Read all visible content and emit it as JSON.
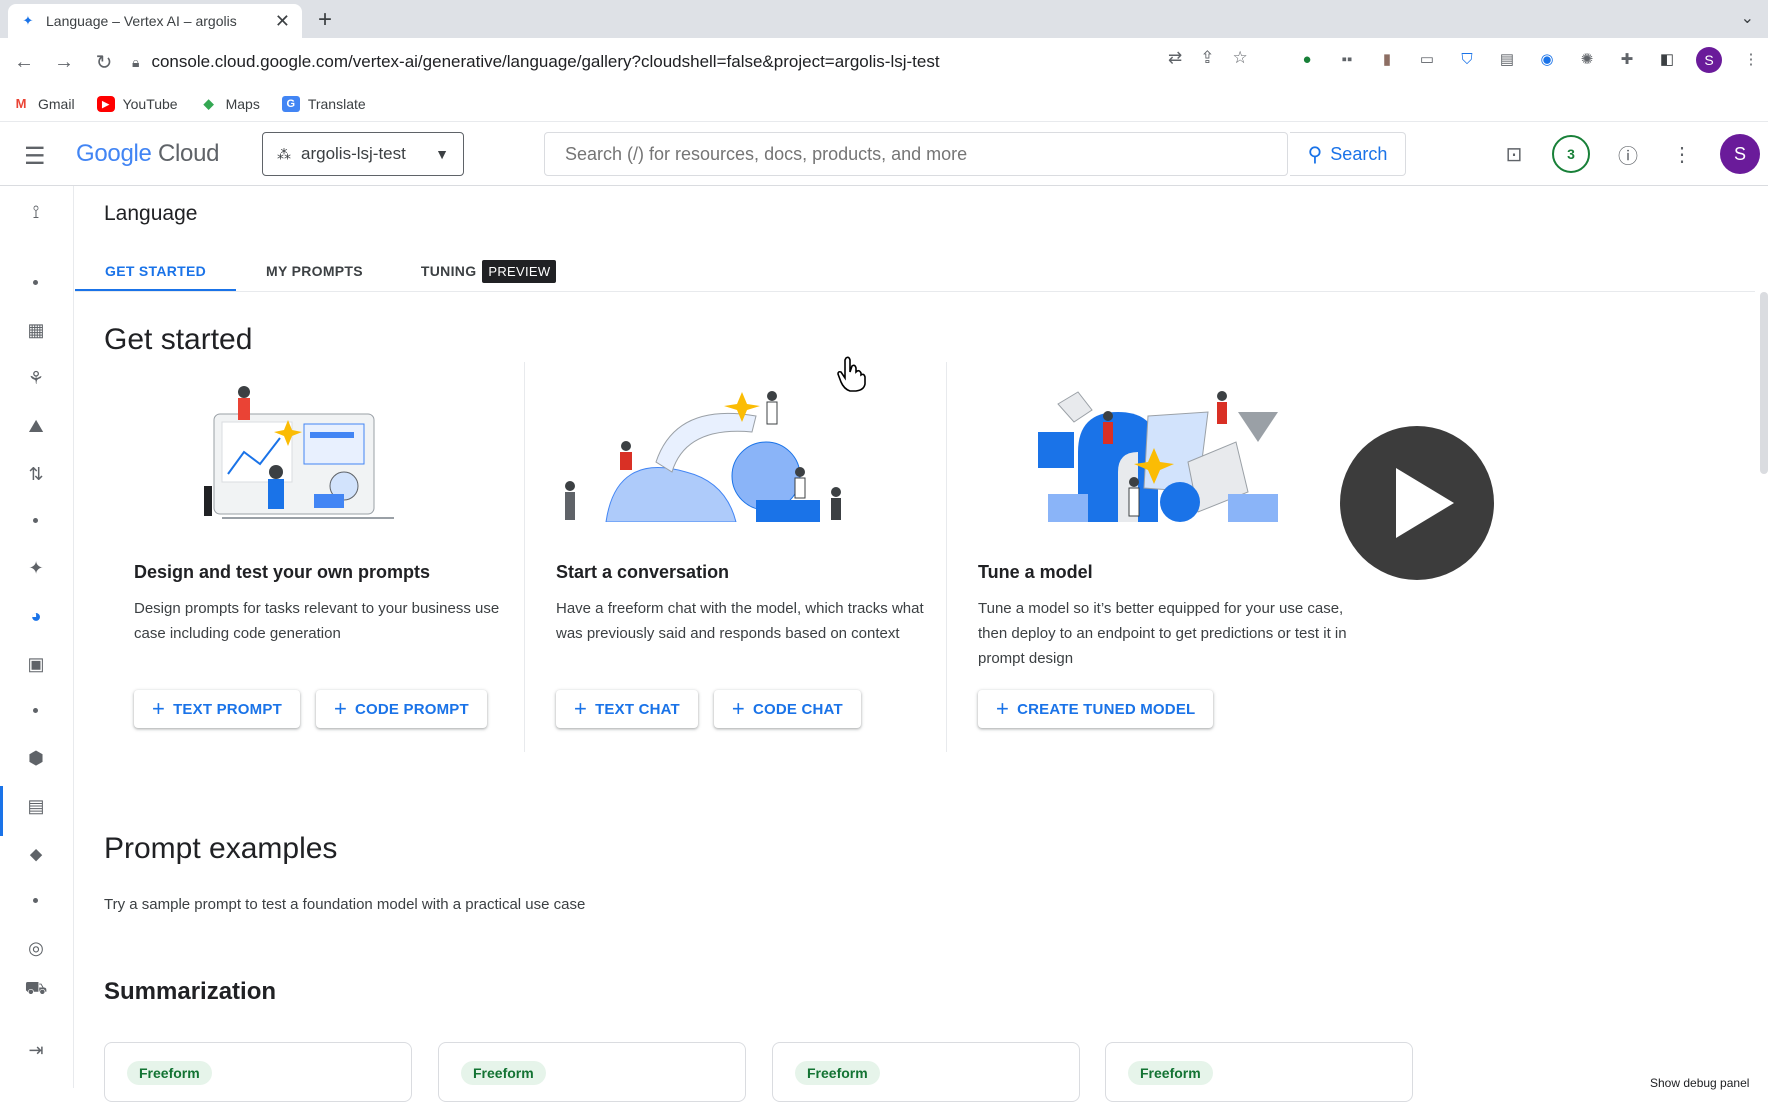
{
  "browser": {
    "tab_title": "Language – Vertex AI – argolis",
    "url": "console.cloud.google.com/vertex-ai/generative/language/gallery?cloudshell=false&project=argolis-lsj-test",
    "bookmarks": [
      {
        "label": "Gmail",
        "icon": "gmail-icon",
        "color": "#ea4335"
      },
      {
        "label": "YouTube",
        "icon": "youtube-icon",
        "color": "#ff0000"
      },
      {
        "label": "Maps",
        "icon": "maps-icon",
        "color": "#34a853"
      },
      {
        "label": "Translate",
        "icon": "translate-icon",
        "color": "#4285f4"
      }
    ],
    "profile_initial": "S"
  },
  "header": {
    "logo_google": "Google",
    "logo_cloud": "Cloud",
    "project": "argolis-lsj-test",
    "search_placeholder": "Search (/) for resources, docs, products, and more",
    "search_button": "Search",
    "notifications_count": "3",
    "avatar_initial": "S"
  },
  "page": {
    "title": "Language",
    "tabs": [
      {
        "label": "GET STARTED",
        "active": true
      },
      {
        "label": "MY PROMPTS",
        "active": false
      },
      {
        "label": "TUNING",
        "badge": "PREVIEW",
        "active": false
      }
    ]
  },
  "get_started": {
    "heading": "Get started",
    "cards": [
      {
        "title": "Design and test your own prompts",
        "description": "Design prompts for tasks relevant to your business use case including code generation",
        "buttons": [
          "TEXT PROMPT",
          "CODE PROMPT"
        ]
      },
      {
        "title": "Start a conversation",
        "description": "Have a freeform chat with the model, which tracks what was previously said and responds based on context",
        "buttons": [
          "TEXT CHAT",
          "CODE CHAT"
        ]
      },
      {
        "title": "Tune a model",
        "description": "Tune a model so it’s better equipped for your use case, then deploy to an endpoint to get predictions or test it in prompt design",
        "buttons": [
          "CREATE TUNED MODEL"
        ]
      }
    ]
  },
  "prompt_examples": {
    "heading": "Prompt examples",
    "subtitle": "Try a sample prompt to test a foundation model with a practical use case",
    "section": "Summarization",
    "cards": [
      {
        "chip": "Freeform"
      },
      {
        "chip": "Freeform"
      },
      {
        "chip": "Freeform"
      },
      {
        "chip": "Freeform"
      }
    ]
  },
  "debug_text": "Show debug panel",
  "colors": {
    "accent": "#1a73e8",
    "avatar": "#6a1b9a",
    "chip_bg": "#e6f4ea",
    "chip_text": "#137333"
  }
}
